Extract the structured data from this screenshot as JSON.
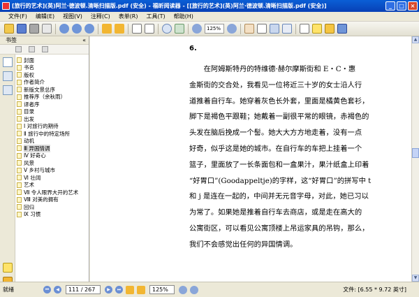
{
  "window": {
    "title": "[旅行的艺术](英)阿兰·德波顿.清晰扫描版.pdf (安全) - 福昕阅读器 - [[旅行的艺术](英)阿兰·德波顿.清晰扫描版.pdf (安全)]",
    "minimize": "_",
    "maximize": "□",
    "close": "×"
  },
  "menu": [
    "文件(F)",
    "编辑(E)",
    "视图(V)",
    "注释(C)",
    "表单(R)",
    "工具(T)",
    "帮助(H)"
  ],
  "toolbar": {
    "zoom_value": "125%",
    "icons": [
      "open-icon",
      "save-icon",
      "print-icon",
      "email-icon",
      "first-page-icon",
      "prev-page-icon",
      "next-page-icon",
      "back-icon",
      "forward-icon",
      "fit-page-icon",
      "fit-width-icon",
      "zoom-icon",
      "rotate-icon",
      "zoom-out-icon",
      "zoom-in-icon",
      "hand-icon",
      "select-text-icon",
      "snapshot-icon",
      "find-icon",
      "typewriter-icon",
      "note-icon",
      "comment-icon",
      "highlight-icon"
    ]
  },
  "sidebar": {
    "title": "书签",
    "collapse": "«",
    "bookmarks": [
      {
        "label": "封面",
        "selected": false
      },
      {
        "label": "书名",
        "selected": false
      },
      {
        "label": "版权",
        "selected": false
      },
      {
        "label": "作者简介",
        "selected": false
      },
      {
        "label": "新版文景总序",
        "selected": false
      },
      {
        "label": "推荐序（余秋雨）",
        "selected": false
      },
      {
        "label": "译者序",
        "selected": false
      },
      {
        "label": "目录",
        "selected": false
      },
      {
        "label": "出发",
        "selected": false
      },
      {
        "label": "Ⅰ 对旅行的期待",
        "selected": false
      },
      {
        "label": "Ⅱ 旅行中的特定场所",
        "selected": false
      },
      {
        "label": "动机",
        "selected": false
      },
      {
        "label": "Ⅲ 异国情调",
        "selected": true
      },
      {
        "label": "Ⅳ 好奇心",
        "selected": false
      },
      {
        "label": "风景",
        "selected": false
      },
      {
        "label": "Ⅴ 乡村与城市",
        "selected": false
      },
      {
        "label": "Ⅵ 壮阔",
        "selected": false
      },
      {
        "label": "艺术",
        "selected": false
      },
      {
        "label": "Ⅶ 令人眼界大开的艺术",
        "selected": false
      },
      {
        "label": "Ⅷ 对美的拥有",
        "selected": false
      },
      {
        "label": "回归",
        "selected": false
      },
      {
        "label": "Ⅸ 习惯",
        "selected": false
      }
    ]
  },
  "document": {
    "page_number": "6.",
    "lines": [
      "　　在阿姆斯特丹的特维德·赫尔摩斯街和 E・C・惠",
      "金斯街的交合处，我看见一位将近三十岁的女士沿人行",
      "道推着自行车。她穿着灰色长外套，里面是橘黄色套衫，",
      "脚下是褐色平跟鞋；她戴着一副很平常的眼镜，赤褐色的",
      "头发在脑后挽成一个髻。她大大方方地走着，没有一点",
      "好奇，似乎这是她的城市。在自行车的车把上挂着一个",
      "篮子，里面放了一长条面包和一盒果汁，果汁纸盒上印着",
      "“好胃口”(Goodappeltje)的字样，这“好胃口”的拼写中 t",
      "和 j 是连在一起的，中间并无元音字母，对此，她已习以",
      "为常了。如果她是推着自行车去商店，或是走在高大的",
      "公寓街区，可以看见公寓顶楼上吊运家具的吊钩，那么，",
      "我们不会感觉出任何的异国情调。"
    ]
  },
  "status": {
    "ready": "就绪",
    "page_field": "111 / 267",
    "zoom_field": "125%",
    "file_info": "文件: [6.55 * 9.72 英寸]"
  }
}
